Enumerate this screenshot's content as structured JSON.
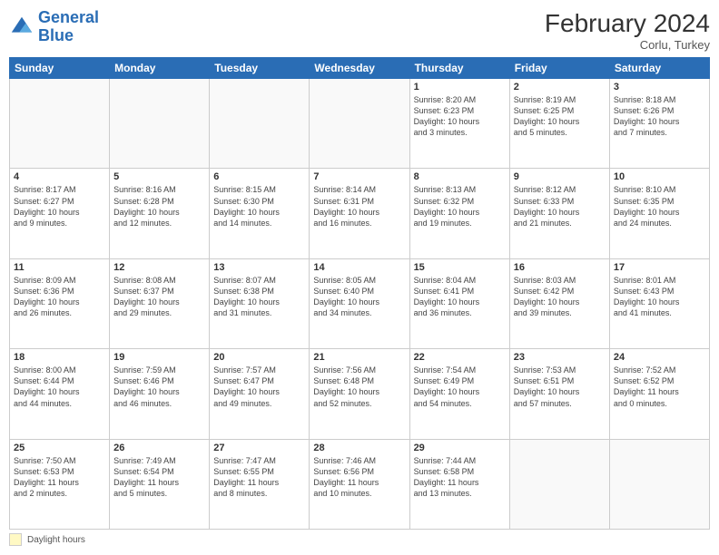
{
  "header": {
    "logo_line1": "General",
    "logo_line2": "Blue",
    "month_year": "February 2024",
    "location": "Corlu, Turkey"
  },
  "days_of_week": [
    "Sunday",
    "Monday",
    "Tuesday",
    "Wednesday",
    "Thursday",
    "Friday",
    "Saturday"
  ],
  "footer": {
    "legend_label": "Daylight hours"
  },
  "weeks": [
    [
      {
        "day": "",
        "info": ""
      },
      {
        "day": "",
        "info": ""
      },
      {
        "day": "",
        "info": ""
      },
      {
        "day": "",
        "info": ""
      },
      {
        "day": "1",
        "info": "Sunrise: 8:20 AM\nSunset: 6:23 PM\nDaylight: 10 hours\nand 3 minutes."
      },
      {
        "day": "2",
        "info": "Sunrise: 8:19 AM\nSunset: 6:25 PM\nDaylight: 10 hours\nand 5 minutes."
      },
      {
        "day": "3",
        "info": "Sunrise: 8:18 AM\nSunset: 6:26 PM\nDaylight: 10 hours\nand 7 minutes."
      }
    ],
    [
      {
        "day": "4",
        "info": "Sunrise: 8:17 AM\nSunset: 6:27 PM\nDaylight: 10 hours\nand 9 minutes."
      },
      {
        "day": "5",
        "info": "Sunrise: 8:16 AM\nSunset: 6:28 PM\nDaylight: 10 hours\nand 12 minutes."
      },
      {
        "day": "6",
        "info": "Sunrise: 8:15 AM\nSunset: 6:30 PM\nDaylight: 10 hours\nand 14 minutes."
      },
      {
        "day": "7",
        "info": "Sunrise: 8:14 AM\nSunset: 6:31 PM\nDaylight: 10 hours\nand 16 minutes."
      },
      {
        "day": "8",
        "info": "Sunrise: 8:13 AM\nSunset: 6:32 PM\nDaylight: 10 hours\nand 19 minutes."
      },
      {
        "day": "9",
        "info": "Sunrise: 8:12 AM\nSunset: 6:33 PM\nDaylight: 10 hours\nand 21 minutes."
      },
      {
        "day": "10",
        "info": "Sunrise: 8:10 AM\nSunset: 6:35 PM\nDaylight: 10 hours\nand 24 minutes."
      }
    ],
    [
      {
        "day": "11",
        "info": "Sunrise: 8:09 AM\nSunset: 6:36 PM\nDaylight: 10 hours\nand 26 minutes."
      },
      {
        "day": "12",
        "info": "Sunrise: 8:08 AM\nSunset: 6:37 PM\nDaylight: 10 hours\nand 29 minutes."
      },
      {
        "day": "13",
        "info": "Sunrise: 8:07 AM\nSunset: 6:38 PM\nDaylight: 10 hours\nand 31 minutes."
      },
      {
        "day": "14",
        "info": "Sunrise: 8:05 AM\nSunset: 6:40 PM\nDaylight: 10 hours\nand 34 minutes."
      },
      {
        "day": "15",
        "info": "Sunrise: 8:04 AM\nSunset: 6:41 PM\nDaylight: 10 hours\nand 36 minutes."
      },
      {
        "day": "16",
        "info": "Sunrise: 8:03 AM\nSunset: 6:42 PM\nDaylight: 10 hours\nand 39 minutes."
      },
      {
        "day": "17",
        "info": "Sunrise: 8:01 AM\nSunset: 6:43 PM\nDaylight: 10 hours\nand 41 minutes."
      }
    ],
    [
      {
        "day": "18",
        "info": "Sunrise: 8:00 AM\nSunset: 6:44 PM\nDaylight: 10 hours\nand 44 minutes."
      },
      {
        "day": "19",
        "info": "Sunrise: 7:59 AM\nSunset: 6:46 PM\nDaylight: 10 hours\nand 46 minutes."
      },
      {
        "day": "20",
        "info": "Sunrise: 7:57 AM\nSunset: 6:47 PM\nDaylight: 10 hours\nand 49 minutes."
      },
      {
        "day": "21",
        "info": "Sunrise: 7:56 AM\nSunset: 6:48 PM\nDaylight: 10 hours\nand 52 minutes."
      },
      {
        "day": "22",
        "info": "Sunrise: 7:54 AM\nSunset: 6:49 PM\nDaylight: 10 hours\nand 54 minutes."
      },
      {
        "day": "23",
        "info": "Sunrise: 7:53 AM\nSunset: 6:51 PM\nDaylight: 10 hours\nand 57 minutes."
      },
      {
        "day": "24",
        "info": "Sunrise: 7:52 AM\nSunset: 6:52 PM\nDaylight: 11 hours\nand 0 minutes."
      }
    ],
    [
      {
        "day": "25",
        "info": "Sunrise: 7:50 AM\nSunset: 6:53 PM\nDaylight: 11 hours\nand 2 minutes."
      },
      {
        "day": "26",
        "info": "Sunrise: 7:49 AM\nSunset: 6:54 PM\nDaylight: 11 hours\nand 5 minutes."
      },
      {
        "day": "27",
        "info": "Sunrise: 7:47 AM\nSunset: 6:55 PM\nDaylight: 11 hours\nand 8 minutes."
      },
      {
        "day": "28",
        "info": "Sunrise: 7:46 AM\nSunset: 6:56 PM\nDaylight: 11 hours\nand 10 minutes."
      },
      {
        "day": "29",
        "info": "Sunrise: 7:44 AM\nSunset: 6:58 PM\nDaylight: 11 hours\nand 13 minutes."
      },
      {
        "day": "",
        "info": ""
      },
      {
        "day": "",
        "info": ""
      }
    ]
  ]
}
